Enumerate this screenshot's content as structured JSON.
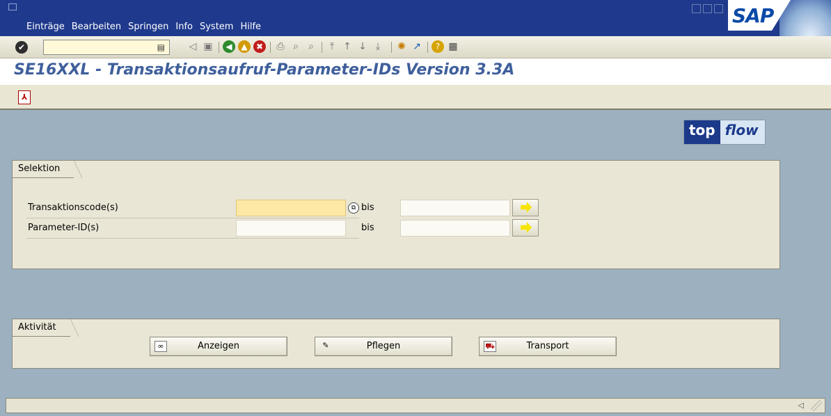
{
  "menu": {
    "items": [
      "Einträge",
      "Bearbeiten",
      "Springen",
      "Info",
      "System",
      "Hilfe"
    ]
  },
  "brand": {
    "logo_text": "SAP"
  },
  "toolbar": {
    "command_value": "",
    "icons": [
      "save-icon",
      "back-icon",
      "exit-icon",
      "cancel-icon",
      "print-icon",
      "find-icon",
      "find-next-icon",
      "first-page-icon",
      "previous-page-icon",
      "next-page-icon",
      "last-page-icon",
      "new-session-icon",
      "shortcut-icon",
      "help-icon",
      "layout-icon"
    ]
  },
  "title": "SE16XXL - Transaktionsaufruf-Parameter-IDs Version 3.3A",
  "app_logo": {
    "part1": "top",
    "part2": "flow"
  },
  "selection": {
    "title": "Selektion",
    "rows": [
      {
        "label": "Transaktionscode(s)",
        "from_value": "",
        "bis": "bis",
        "to_value": ""
      },
      {
        "label": "Parameter-ID(s)",
        "from_value": "",
        "bis": "bis",
        "to_value": ""
      }
    ]
  },
  "activity": {
    "title": "Aktivität",
    "buttons": [
      {
        "label": "Anzeigen",
        "icon": "glasses-icon"
      },
      {
        "label": "Pflegen",
        "icon": "pencil-icon"
      },
      {
        "label": "Transport",
        "icon": "truck-icon"
      }
    ]
  },
  "colors": {
    "menubar": "#1f3a8c",
    "title_text": "#3f5f9c",
    "background": "#9cb0c0",
    "required_field": "#fde8a6"
  }
}
